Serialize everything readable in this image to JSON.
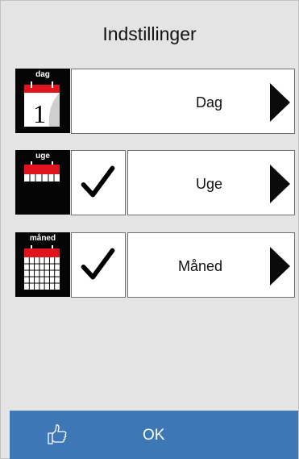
{
  "header": {
    "title": "Indstillinger"
  },
  "rows": [
    {
      "icon_label": "dag",
      "icon": "day-calendar-icon",
      "label": "Dag",
      "checked": null
    },
    {
      "icon_label": "uge",
      "icon": "week-calendar-icon",
      "label": "Uge",
      "checked": true
    },
    {
      "icon_label": "måned",
      "icon": "month-calendar-icon",
      "label": "Måned",
      "checked": true
    }
  ],
  "footer": {
    "ok_label": "OK",
    "icon": "thumbs-up-icon"
  },
  "colors": {
    "background": "#e4e4e4",
    "ok_bar": "#3d77b5",
    "calendar_red": "#e0141c"
  }
}
